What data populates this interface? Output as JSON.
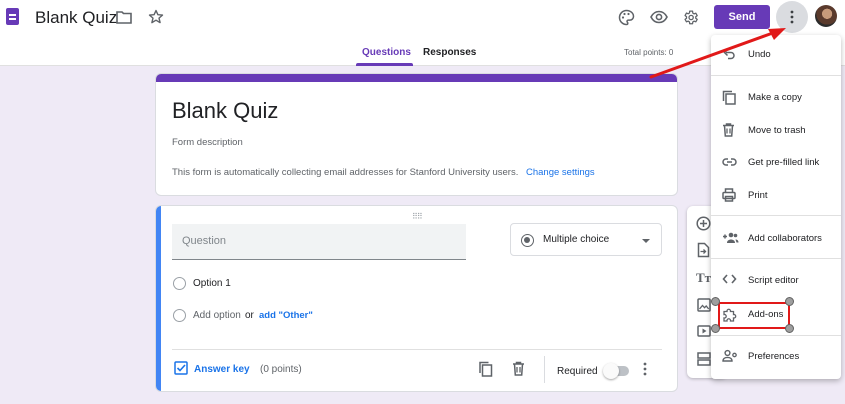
{
  "header": {
    "title": "Blank Quiz",
    "send_label": "Send"
  },
  "tabs": [
    {
      "label": "Questions",
      "active": true
    },
    {
      "label": "Responses",
      "active": false
    }
  ],
  "total_points": "Total points: 0",
  "form": {
    "title": "Blank Quiz",
    "description_placeholder": "Form description",
    "email_notice": "This form is automatically collecting email addresses for Stanford University users.",
    "change_settings_link": "Change settings"
  },
  "question": {
    "placeholder": "Question",
    "type": "Multiple choice",
    "option_1": "Option 1",
    "add_option": "Add option",
    "or_text": "or",
    "add_other": "add \"Other\"",
    "answer_key": "Answer key",
    "points": "(0 points)",
    "required_label": "Required",
    "required": false
  },
  "toolbar_icons": [
    "add-question-icon",
    "import-questions-icon",
    "add-title-icon",
    "add-image-icon",
    "add-video-icon",
    "add-section-icon"
  ],
  "menu": {
    "items": [
      {
        "label": "Undo",
        "icon": "undo-icon"
      },
      {
        "label": "Make a copy",
        "icon": "copy-icon"
      },
      {
        "label": "Move to trash",
        "icon": "trash-icon"
      },
      {
        "label": "Get pre-filled link",
        "icon": "link-icon"
      },
      {
        "label": "Print",
        "icon": "print-icon"
      },
      {
        "label": "Add collaborators",
        "icon": "add-collaborators-icon"
      },
      {
        "label": "Script editor",
        "icon": "code-icon"
      },
      {
        "label": "Add-ons",
        "icon": "puzzle-icon"
      },
      {
        "label": "Preferences",
        "icon": "preferences-icon"
      }
    ]
  },
  "colors": {
    "brand": "#673ab7",
    "link": "#1a73e8",
    "annotation": "#e11919",
    "background": "#efeaf6"
  }
}
